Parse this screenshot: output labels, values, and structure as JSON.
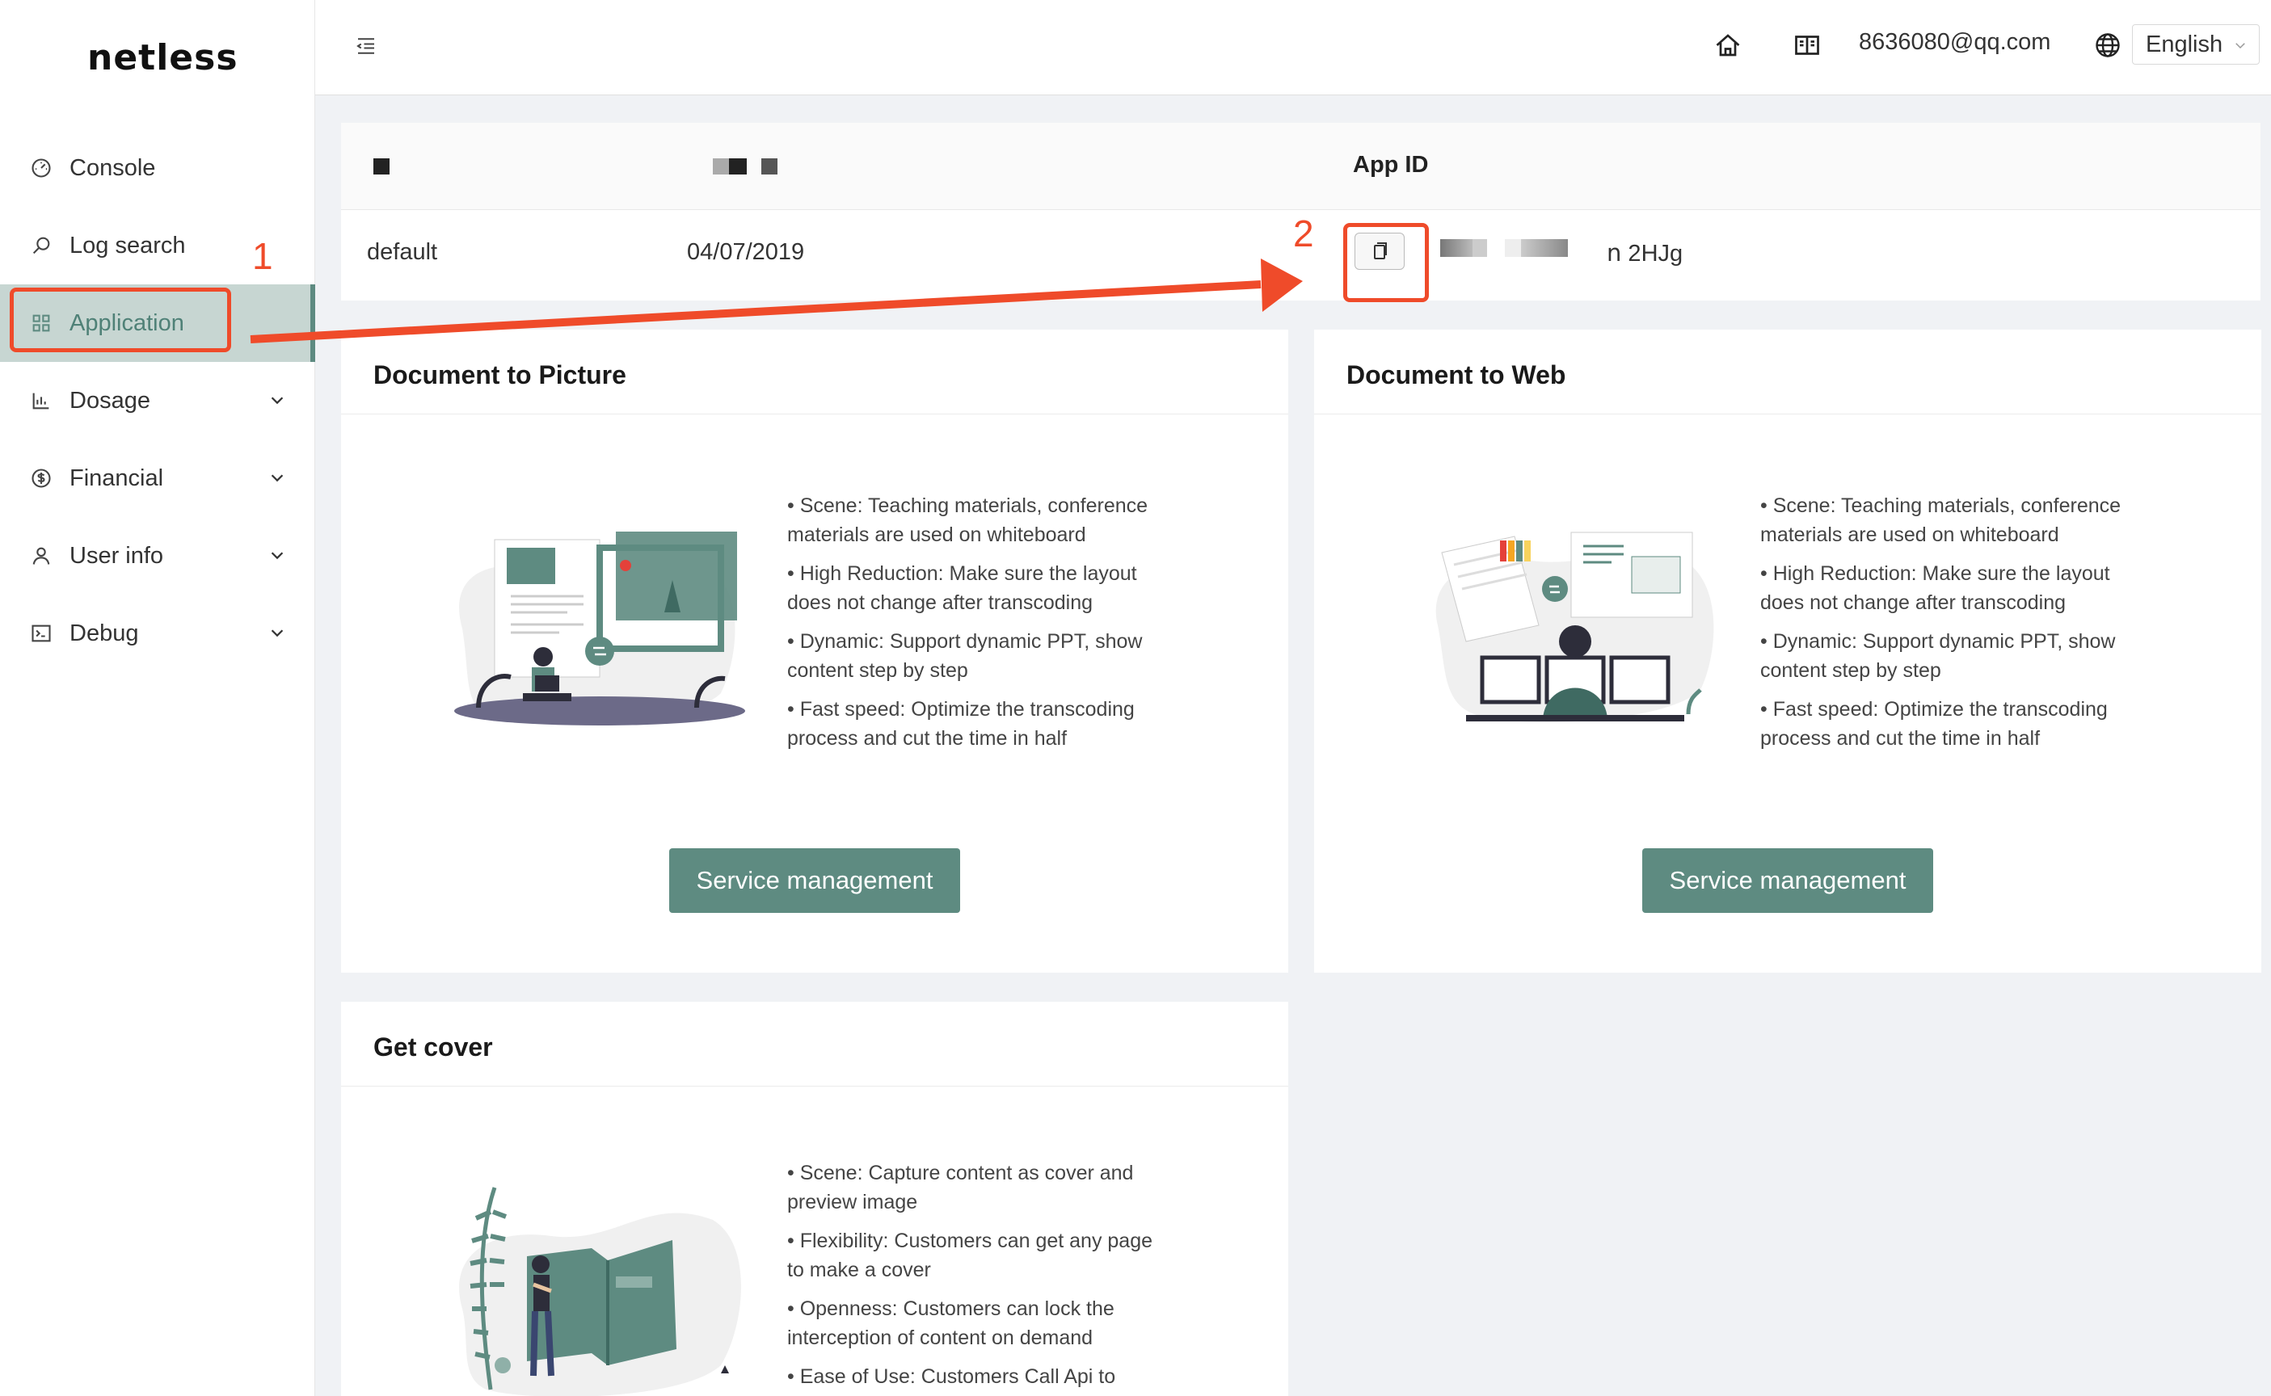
{
  "sidebar": {
    "logo": "netless",
    "items": [
      {
        "label": "Console",
        "icon": "dashboard-icon"
      },
      {
        "label": "Log search",
        "icon": "search-icon"
      },
      {
        "label": "Application",
        "icon": "grid-icon"
      },
      {
        "label": "Dosage",
        "icon": "bar-chart-icon"
      },
      {
        "label": "Financial",
        "icon": "dollar-icon"
      },
      {
        "label": "User info",
        "icon": "user-icon"
      },
      {
        "label": "Debug",
        "icon": "terminal-icon"
      }
    ]
  },
  "header": {
    "email": "8636080@qq.com",
    "language": "English"
  },
  "app_table": {
    "headers": {
      "app_id": "App ID"
    },
    "row": {
      "name": "default",
      "date": "04/07/2019",
      "app_id_tail": "ո 2HJg"
    }
  },
  "annotations": {
    "step1": "1",
    "step2": "2"
  },
  "cards": [
    {
      "title": "Document to Picture",
      "features": [
        "Scene: Teaching materials, conference materials are used on whiteboard",
        "High Reduction: Make sure the layout does not change after transcoding",
        "Dynamic: Support dynamic PPT, show content step by step",
        "Fast speed: Optimize the transcoding process and cut the time in half"
      ],
      "button": "Service management"
    },
    {
      "title": "Document to Web",
      "features": [
        "Scene: Teaching materials, conference materials are used on whiteboard",
        "High Reduction: Make sure the layout does not change after transcoding",
        "Dynamic: Support dynamic PPT, show content step by step",
        "Fast speed: Optimize the transcoding process and cut the time in half"
      ],
      "button": "Service management"
    },
    {
      "title": "Get cover",
      "features": [
        "Scene: Capture content as cover and preview image",
        "Flexibility: Customers can get any page to make a cover",
        "Openness: Customers can lock the interception of content on demand",
        "Ease of Use: Customers Call Api to"
      ]
    }
  ],
  "colors": {
    "accent": "#5e8b81",
    "active_bg": "#c7d6d2",
    "annotation": "#ef4b2a"
  }
}
